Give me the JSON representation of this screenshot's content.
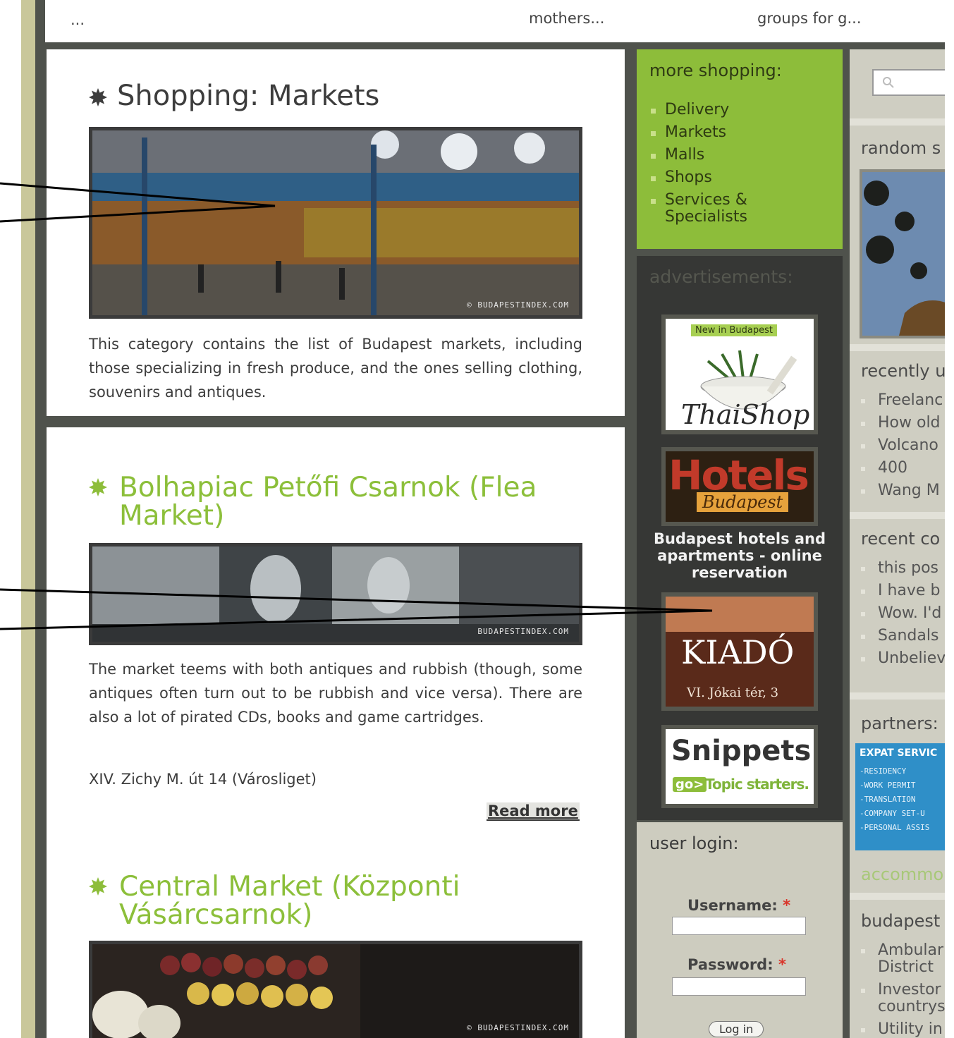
{
  "top_bar": {
    "ellipsis": "...",
    "link_mothers": "mothers...",
    "link_groups": "groups for g..."
  },
  "page": {
    "title": "Shopping: Markets",
    "description": "This category contains the list of Budapest markets, including those specializing in fresh produce, and the ones selling clothing, souvenirs and antiques.",
    "watermark": "© BUDAPESTINDEX.COM"
  },
  "items": [
    {
      "title": "Bolhapiac Petőfi Csarnok (Flea Market)",
      "description": "The market teems with both antiques and rubbish (though, some antiques often turn out to be rubbish and vice versa). There are also a lot of pirated CDs, books and game cartridges.",
      "address": "XIV. Zichy M. út 14 (Városliget)",
      "read_more": "Read more",
      "watermark": "BUDAPESTINDEX.COM"
    },
    {
      "title": "Central Market (Központi Vásárcsarnok)",
      "watermark": "© BUDAPESTINDEX.COM"
    }
  ],
  "sidebar": {
    "more_shopping": {
      "title": "more shopping:",
      "links": [
        "Delivery",
        "Markets",
        "Malls",
        "Shops",
        "Services & Specialists"
      ]
    },
    "ads": {
      "title": "advertisements:",
      "thaishop": {
        "badge": "New in Budapest",
        "brand": "ThaiShop"
      },
      "hotels": {
        "word": "Hotels",
        "script": "Budapest",
        "caption": "Budapest hotels and apartments - online reservation"
      },
      "kiado": {
        "word": "KIADÓ",
        "address": "VI. Jókai tér, 3"
      },
      "snippets": {
        "word": "Snippets!",
        "go": "go>",
        "tagline": "Topic starters."
      }
    },
    "login": {
      "title": "user login:",
      "username_label": "Username:",
      "password_label": "Password:",
      "required_mark": "*",
      "button": "Log in"
    }
  },
  "right_column": {
    "random_title": "random s",
    "recently_title": "recently u",
    "recently_items": [
      "Freelanc",
      "How old",
      "Volcano",
      "400",
      "Wang M"
    ],
    "recent_comments_title": "recent co",
    "recent_comments_items": [
      "this pos",
      "I have b",
      "Wow. I'd",
      "Sandals",
      "Unbeliev"
    ],
    "partners_title": "partners:",
    "partner_banner": {
      "title": "EXPAT SERVIC",
      "lines": [
        "-RESIDENCY",
        "-WORK PERMIT",
        "-TRANSLATION",
        "-COMPANY SET-U",
        "-PERSONAL ASSIS"
      ]
    },
    "accommodation_title": "accommo",
    "budapest_title": "budapest",
    "budapest_items": [
      "Ambular District",
      "Investor countrys",
      "Utility in"
    ]
  },
  "colors": {
    "accent_green": "#8dbd3a",
    "frame_dark": "#4f524c",
    "sidebar_beige": "#cfcec2"
  }
}
